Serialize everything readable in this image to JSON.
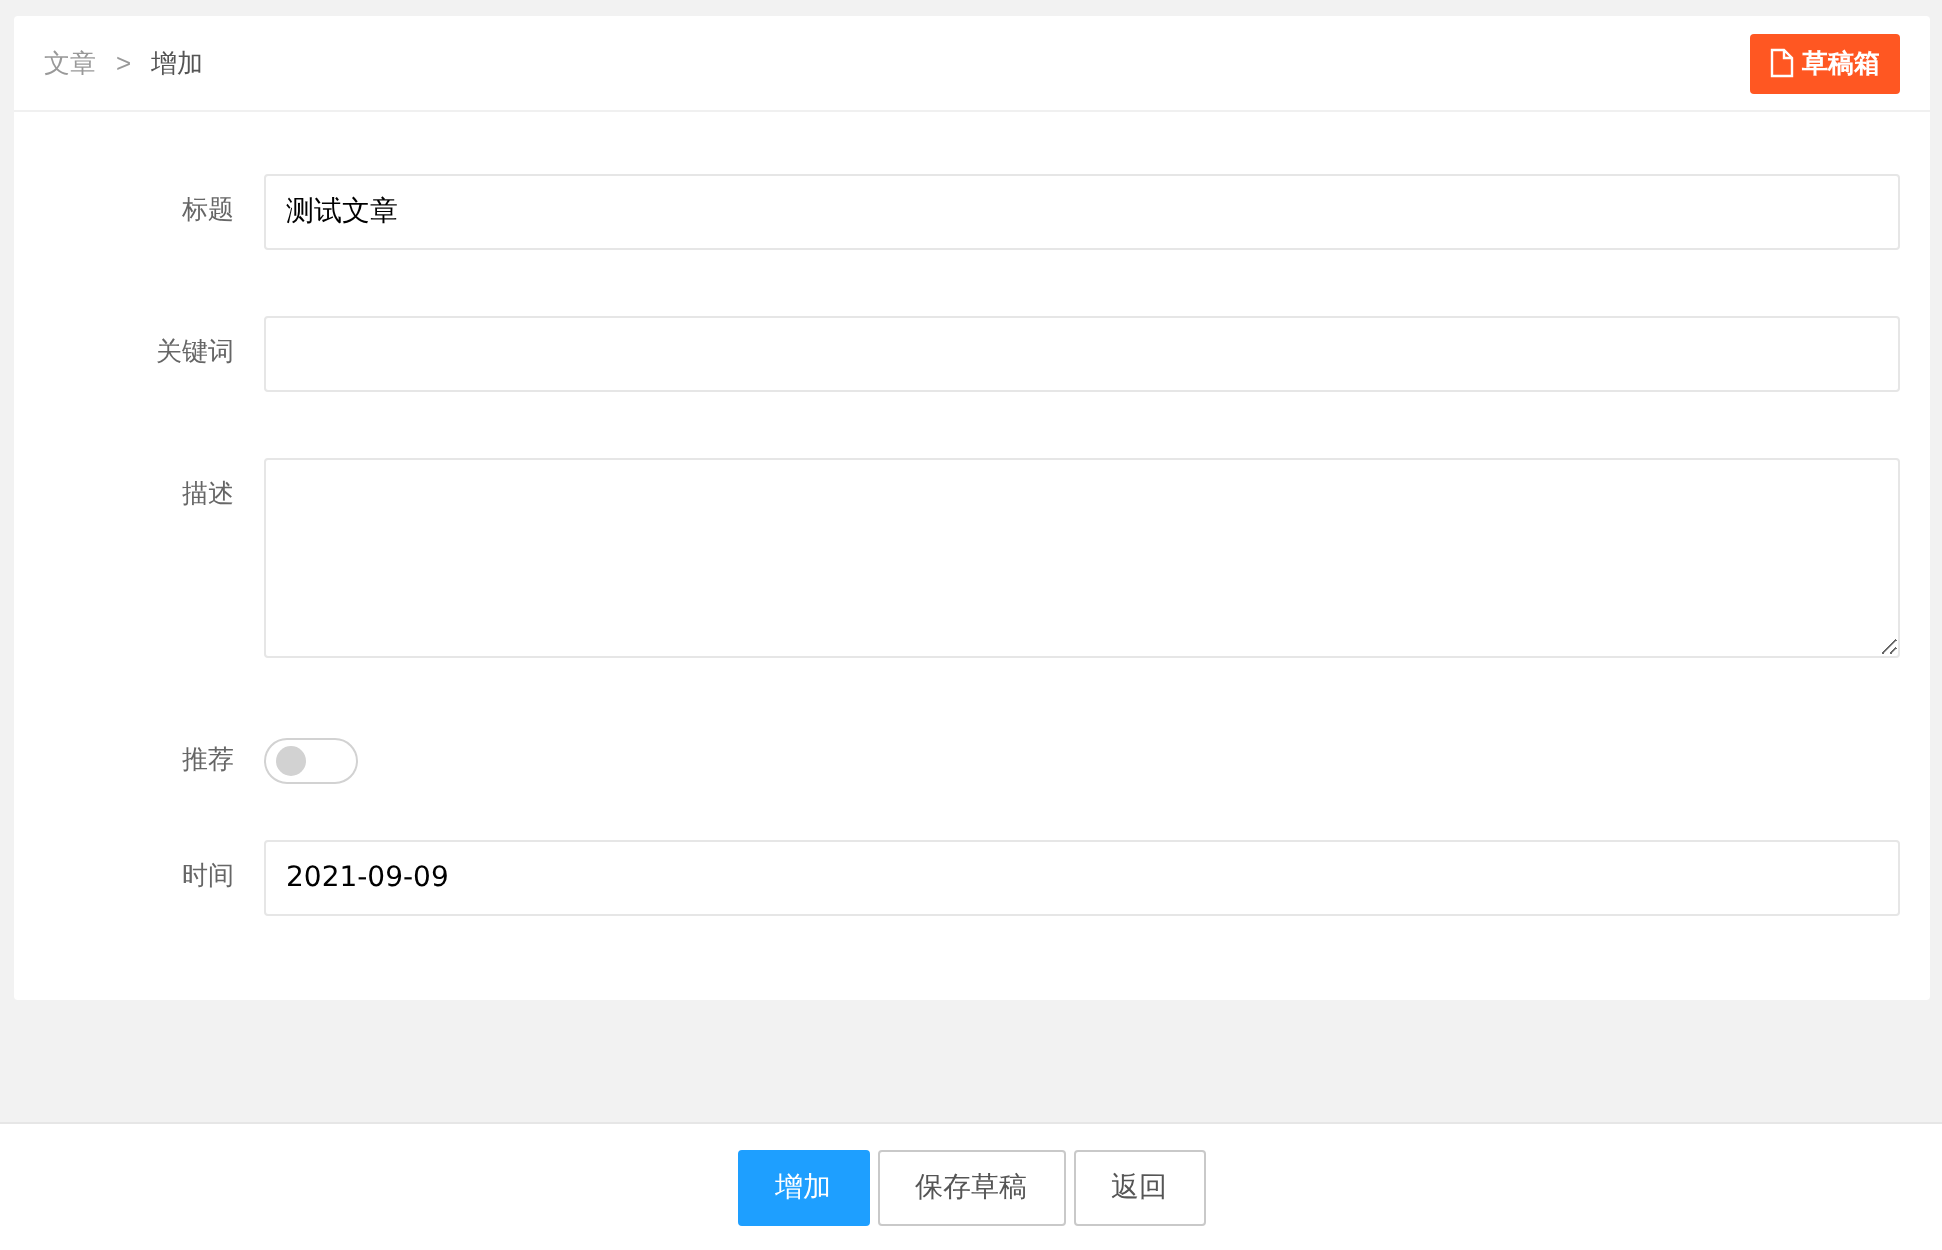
{
  "breadcrumb": [
    {
      "label": "文章",
      "current": false
    },
    {
      "label": "增加",
      "current": true
    }
  ],
  "breadcrumb_separator": ">",
  "drafts_button": {
    "label": "草稿箱"
  },
  "fields": [
    {
      "kind": "text",
      "label": "标题",
      "value": "测试文章"
    },
    {
      "kind": "text",
      "label": "关键词"
    },
    {
      "kind": "textarea",
      "label": "描述"
    },
    {
      "kind": "switch",
      "label": "推荐",
      "on": false
    },
    {
      "kind": "text",
      "label": "时间",
      "value": "2021-09-09"
    }
  ],
  "buttons": [
    {
      "label": "增加",
      "kind": "primary"
    },
    {
      "label": "保存草稿",
      "kind": "default"
    },
    {
      "label": "返回",
      "kind": "default"
    }
  ]
}
